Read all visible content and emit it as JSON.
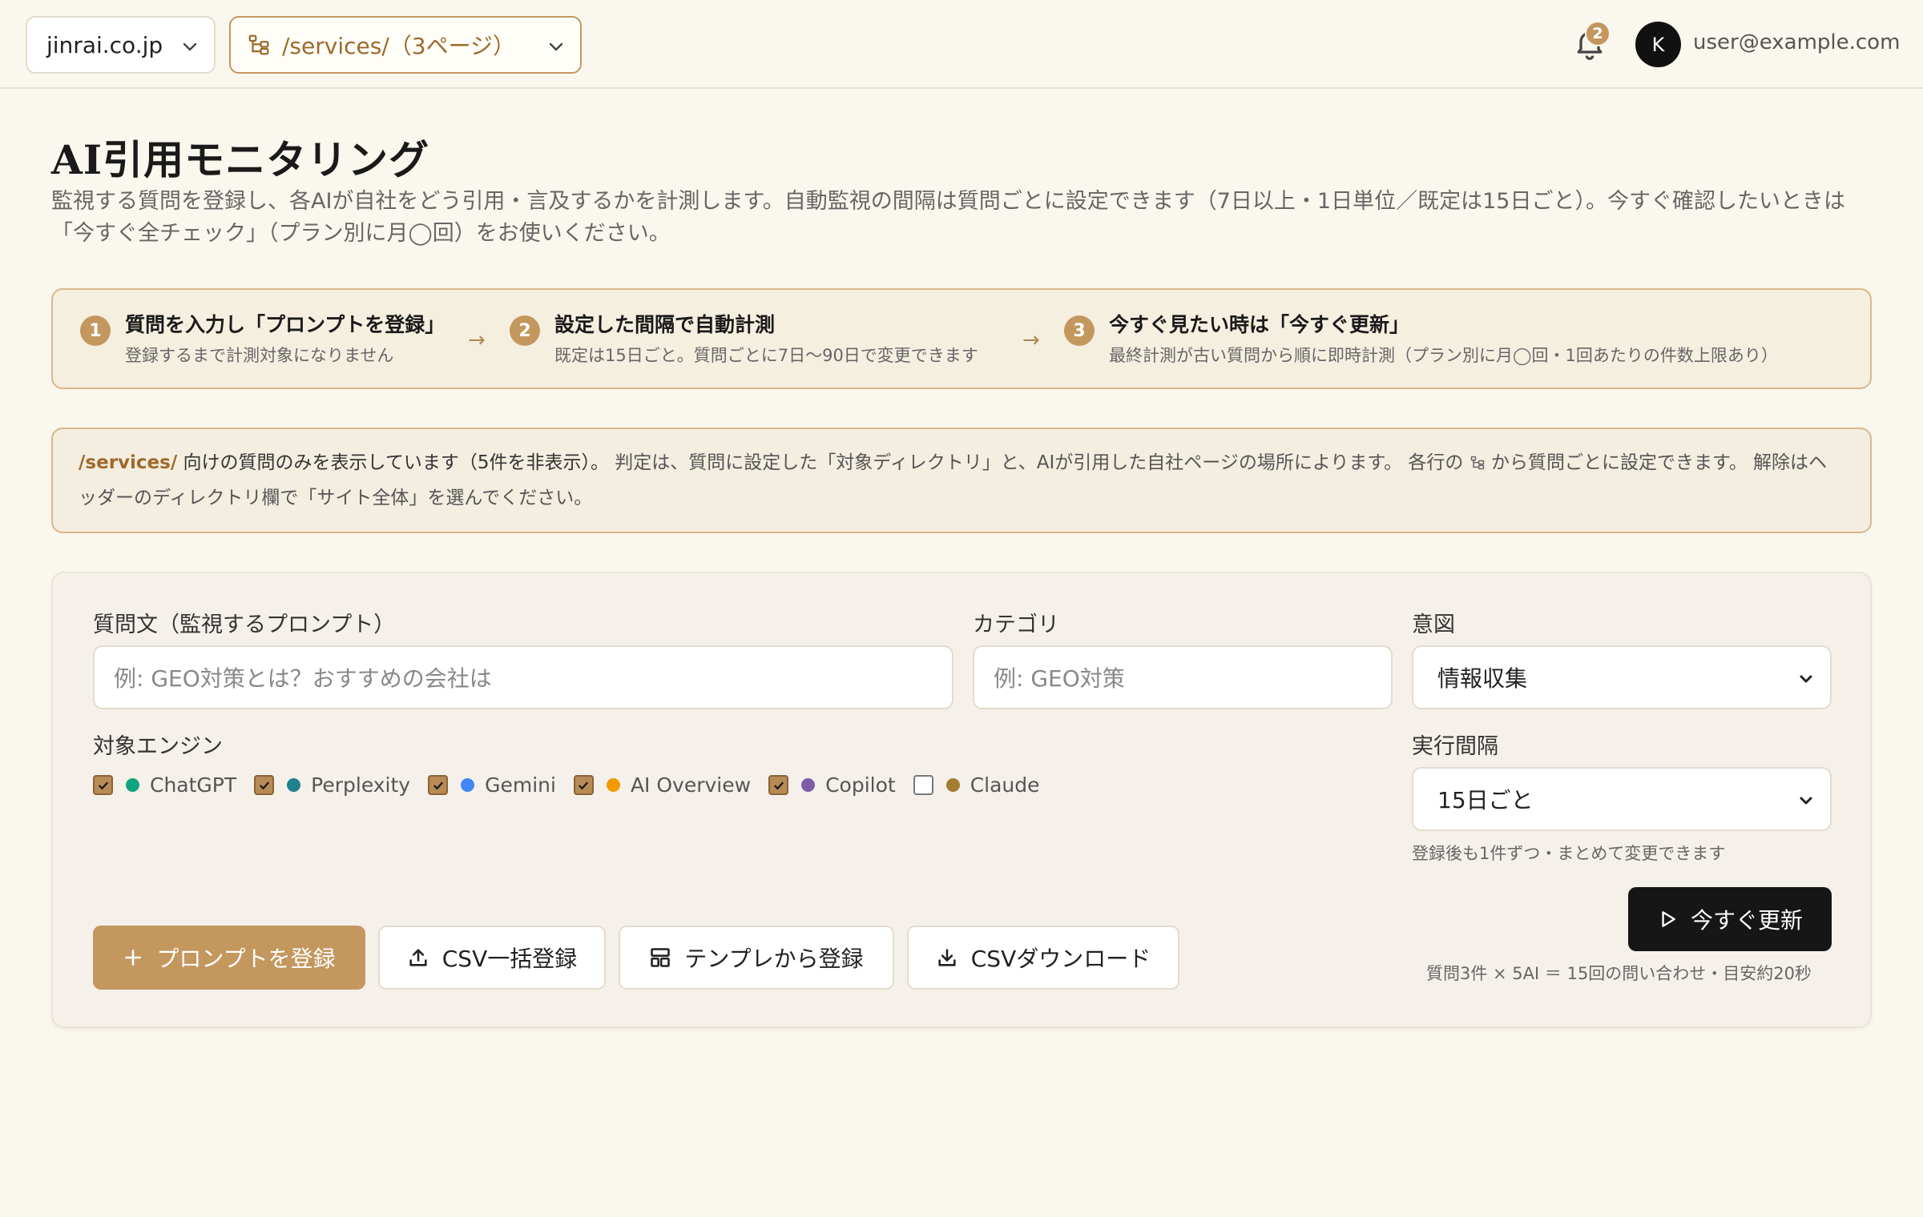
{
  "header": {
    "site": "jinrai.co.jp",
    "directory": "/services/（3ページ）",
    "notification_count": "2",
    "avatar_initial": "K",
    "user_email": "user@example.com"
  },
  "page": {
    "title": "AI引用モニタリング",
    "description": "監視する質問を登録し、各AIが自社をどう引用・言及するかを計測します。自動監視の間隔は質問ごとに設定できます（7日以上・1日単位／既定は15日ごと）。今すぐ確認したいときは「今すぐ全チェック」（プラン別に月◯回）をお使いください。"
  },
  "steps": [
    {
      "num": "1",
      "title": "質問を入力し「プロンプトを登録」",
      "desc": "登録するまで計測対象になりません"
    },
    {
      "num": "2",
      "title": "設定した間隔で自動計測",
      "desc": "既定は15日ごと。質問ごとに7日〜90日で変更できます"
    },
    {
      "num": "3",
      "title": "今すぐ見たい時は「今すぐ更新」",
      "desc": "最終計測が古い質問から順に即時計測（プラン別に月◯回・1回あたりの件数上限あり）"
    }
  ],
  "notice": {
    "dir": "/services/",
    "lead": " 向けの質問のみを表示しています（5件を非表示）。",
    "body": " 判定は、質問に設定した「対象ディレクトリ」と、AIが引用した自社ページの場所によります。 各行の ",
    "tail": " から質問ごとに設定できます。 解除はヘッダーのディレクトリ欄で「サイト全体」を選んでください。"
  },
  "form": {
    "question_label": "質問文（監視するプロンプト）",
    "question_placeholder": "例: GEO対策とは？おすすめの会社は",
    "category_label": "カテゴリ",
    "category_placeholder": "例: GEO対策",
    "intent_label": "意図",
    "intent_value": "情報収集",
    "engines_label": "対象エンジン",
    "engines": [
      {
        "name": "ChatGPT",
        "checked": true,
        "color": "#10a37f"
      },
      {
        "name": "Perplexity",
        "checked": true,
        "color": "#20808d"
      },
      {
        "name": "Gemini",
        "checked": true,
        "color": "#4285f4"
      },
      {
        "name": "AI Overview",
        "checked": true,
        "color": "#f29900"
      },
      {
        "name": "Copilot",
        "checked": true,
        "color": "#7b5ea7"
      },
      {
        "name": "Claude",
        "checked": false,
        "color": "#a67c2e"
      }
    ],
    "interval_label": "実行間隔",
    "interval_value": "15日ごと",
    "interval_hint": "登録後も1件ずつ・まとめて変更できます"
  },
  "actions": {
    "register": "プロンプトを登録",
    "csv_bulk": "CSV一括登録",
    "template": "テンプレから登録",
    "csv_download": "CSVダウンロード",
    "update_now": "今すぐ更新",
    "update_hint": "質問3件 × 5AI ＝ 15回の問い合わせ・目安約20秒"
  }
}
